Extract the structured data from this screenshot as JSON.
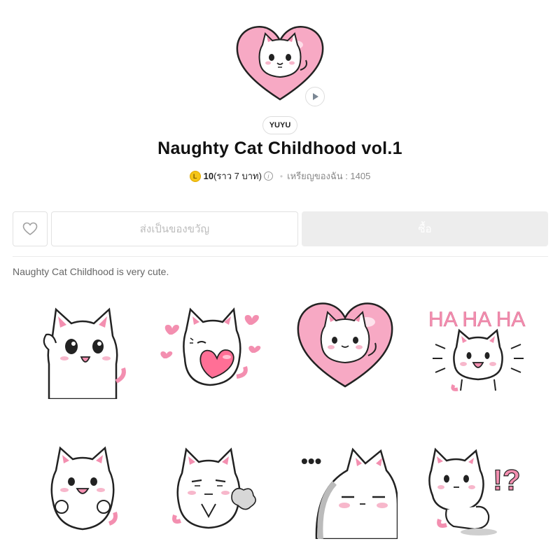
{
  "package": {
    "author": "YUYU",
    "title": "Naughty Cat Childhood vol.1",
    "coin_glyph": "L",
    "price": "10",
    "price_approx": "(ราว 7 บาท)",
    "balance": "เหรียญของฉัน : 1405",
    "description": "Naughty Cat Childhood is very cute."
  },
  "actions": {
    "gift_label": "ส่งเป็นของขวัญ",
    "buy_label": "ซื้อ"
  },
  "stickers": [
    {
      "name": "cat-waving",
      "caption": ""
    },
    {
      "name": "cat-hugging-heart",
      "caption": ""
    },
    {
      "name": "cat-in-heart",
      "caption": ""
    },
    {
      "name": "cat-laughing",
      "caption": "HA HA HA"
    },
    {
      "name": "cat-cheering",
      "caption": ""
    },
    {
      "name": "cat-sighing",
      "caption": ""
    },
    {
      "name": "cat-peeking",
      "caption": "•••"
    },
    {
      "name": "cat-confused",
      "caption": "!?"
    }
  ],
  "colors": {
    "accent_pink": "#f38fb0",
    "coin": "#f5c518",
    "buy_disabled": "#ededed"
  }
}
